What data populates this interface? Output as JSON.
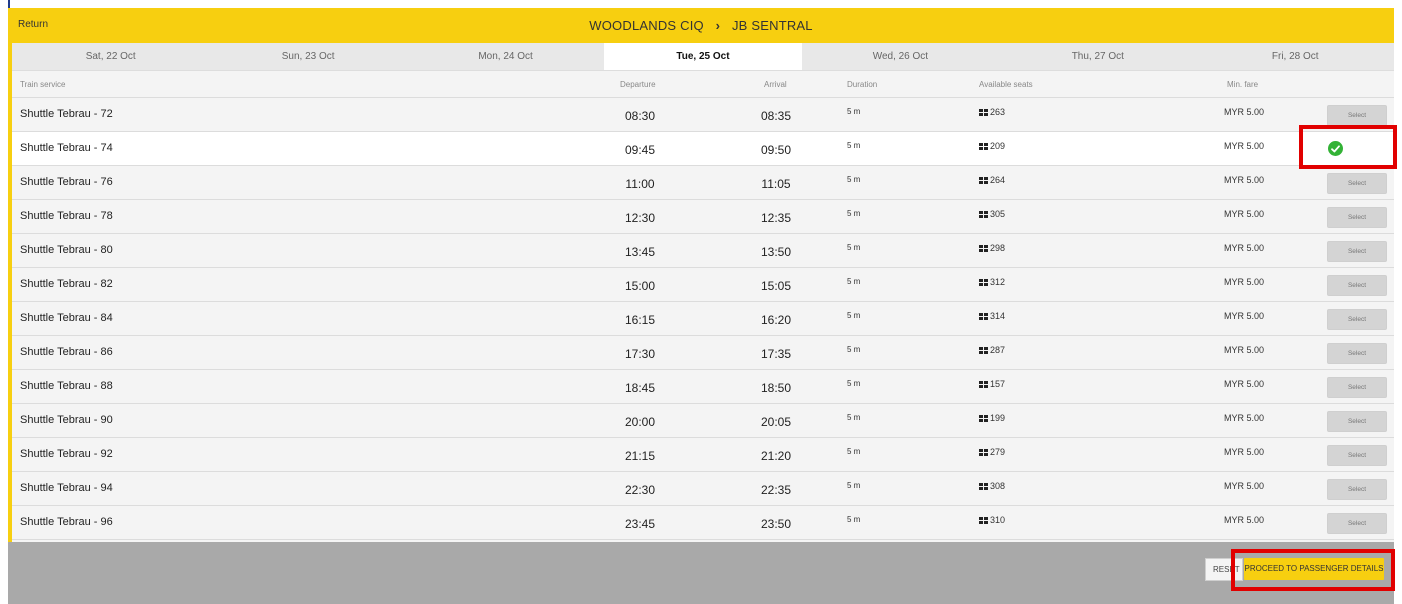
{
  "header": {
    "return_label": "Return",
    "origin": "WOODLANDS CIQ",
    "separator": "›",
    "destination": "JB SENTRAL"
  },
  "tabs": [
    {
      "label": "Sat, 22 Oct"
    },
    {
      "label": "Sun, 23 Oct"
    },
    {
      "label": "Mon, 24 Oct"
    },
    {
      "label": "Tue, 25 Oct",
      "active": true
    },
    {
      "label": "Wed, 26 Oct"
    },
    {
      "label": "Thu, 27 Oct"
    },
    {
      "label": "Fri, 28 Oct"
    }
  ],
  "columns": {
    "service": "Train service",
    "departure": "Departure",
    "arrival": "Arrival",
    "duration": "Duration",
    "seats": "Available seats",
    "fare": "Min. fare"
  },
  "select_label": "Select",
  "rows": [
    {
      "service": "Shuttle Tebrau - 72",
      "departure": "08:30",
      "arrival": "08:35",
      "duration": "5 m",
      "seats": "263",
      "fare": "MYR 5.00"
    },
    {
      "service": "Shuttle Tebrau - 74",
      "departure": "09:45",
      "arrival": "09:50",
      "duration": "5 m",
      "seats": "209",
      "fare": "MYR 5.00",
      "selected": true
    },
    {
      "service": "Shuttle Tebrau - 76",
      "departure": "11:00",
      "arrival": "11:05",
      "duration": "5 m",
      "seats": "264",
      "fare": "MYR 5.00"
    },
    {
      "service": "Shuttle Tebrau - 78",
      "departure": "12:30",
      "arrival": "12:35",
      "duration": "5 m",
      "seats": "305",
      "fare": "MYR 5.00"
    },
    {
      "service": "Shuttle Tebrau - 80",
      "departure": "13:45",
      "arrival": "13:50",
      "duration": "5 m",
      "seats": "298",
      "fare": "MYR 5.00"
    },
    {
      "service": "Shuttle Tebrau - 82",
      "departure": "15:00",
      "arrival": "15:05",
      "duration": "5 m",
      "seats": "312",
      "fare": "MYR 5.00"
    },
    {
      "service": "Shuttle Tebrau - 84",
      "departure": "16:15",
      "arrival": "16:20",
      "duration": "5 m",
      "seats": "314",
      "fare": "MYR 5.00"
    },
    {
      "service": "Shuttle Tebrau - 86",
      "departure": "17:30",
      "arrival": "17:35",
      "duration": "5 m",
      "seats": "287",
      "fare": "MYR 5.00"
    },
    {
      "service": "Shuttle Tebrau - 88",
      "departure": "18:45",
      "arrival": "18:50",
      "duration": "5 m",
      "seats": "157",
      "fare": "MYR 5.00"
    },
    {
      "service": "Shuttle Tebrau - 90",
      "departure": "20:00",
      "arrival": "20:05",
      "duration": "5 m",
      "seats": "199",
      "fare": "MYR 5.00"
    },
    {
      "service": "Shuttle Tebrau - 92",
      "departure": "21:15",
      "arrival": "21:20",
      "duration": "5 m",
      "seats": "279",
      "fare": "MYR 5.00"
    },
    {
      "service": "Shuttle Tebrau - 94",
      "departure": "22:30",
      "arrival": "22:35",
      "duration": "5 m",
      "seats": "308",
      "fare": "MYR 5.00"
    },
    {
      "service": "Shuttle Tebrau - 96",
      "departure": "23:45",
      "arrival": "23:50",
      "duration": "5 m",
      "seats": "310",
      "fare": "MYR 5.00"
    }
  ],
  "footer": {
    "reset_label": "RESET",
    "proceed_label": "PROCEED TO PASSENGER DETAILS"
  },
  "colors": {
    "brand_yellow": "#f7cf10",
    "selected_check": "#33b236",
    "highlight_red": "#e10000"
  }
}
